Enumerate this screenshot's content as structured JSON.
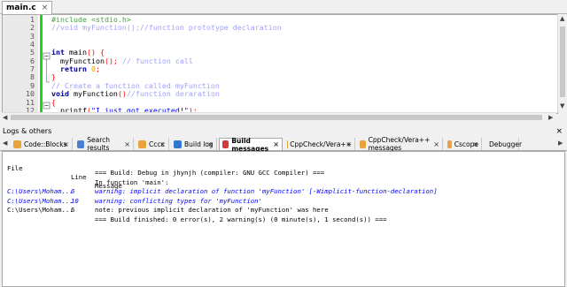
{
  "editor": {
    "tab_label": "main.c",
    "lines": [
      {
        "num": "1",
        "segments": [
          {
            "t": "#include <stdio.h>",
            "c": "pp"
          }
        ]
      },
      {
        "num": "2",
        "segments": [
          {
            "t": "//void myFunction();//function prototype declaration",
            "c": "cm"
          }
        ]
      },
      {
        "num": "3",
        "segments": []
      },
      {
        "num": "4",
        "segments": []
      },
      {
        "num": "5",
        "segments": [
          {
            "t": "int",
            "c": "kw"
          },
          {
            "t": " main",
            "c": "fn"
          },
          {
            "t": "()",
            "c": "sym"
          },
          {
            "t": " {",
            "c": "sym"
          }
        ]
      },
      {
        "num": "6",
        "segments": [
          {
            "t": "  myFunction",
            "c": "fn"
          },
          {
            "t": "();",
            "c": "sym"
          },
          {
            "t": " // function call",
            "c": "cm"
          }
        ]
      },
      {
        "num": "7",
        "segments": [
          {
            "t": "  return",
            "c": "kw"
          },
          {
            "t": " 0",
            "c": "num"
          },
          {
            "t": ";",
            "c": "sym"
          }
        ]
      },
      {
        "num": "8",
        "segments": [
          {
            "t": "}",
            "c": "sym"
          }
        ]
      },
      {
        "num": "9",
        "segments": [
          {
            "t": "// Create a function called myFunction",
            "c": "cm"
          }
        ]
      },
      {
        "num": "10",
        "segments": [
          {
            "t": "void",
            "c": "kw"
          },
          {
            "t": " myFunction",
            "c": "fn"
          },
          {
            "t": "()",
            "c": "sym"
          },
          {
            "t": "//function deraration",
            "c": "cm"
          }
        ]
      },
      {
        "num": "11",
        "segments": [
          {
            "t": "{",
            "c": "sym"
          }
        ]
      },
      {
        "num": "12",
        "segments": [
          {
            "t": "  printf",
            "c": "fn"
          },
          {
            "t": "(",
            "c": "sym"
          },
          {
            "t": "\"I just got executed!\"",
            "c": "str"
          },
          {
            "t": ");",
            "c": "sym"
          }
        ]
      }
    ]
  },
  "logs_panel": {
    "title": "Logs & others",
    "tabs": [
      {
        "label": "Code::Blocks",
        "icon": "codeblocks-icon",
        "color": "#e8a33c"
      },
      {
        "label": "Search results",
        "icon": "search-icon",
        "color": "#4a7fd1"
      },
      {
        "label": "Cccc",
        "icon": "cccc-icon",
        "color": "#e8a33c"
      },
      {
        "label": "Build log",
        "icon": "gear-icon",
        "color": "#2f77d0"
      },
      {
        "label": "Build messages",
        "icon": "build-messages-icon",
        "color": "#d43c3c"
      },
      {
        "label": "CppCheck/Vera++",
        "icon": "cppcheck-icon",
        "color": "#e8a33c"
      },
      {
        "label": "CppCheck/Vera++ messages",
        "icon": "cppcheck-messages-icon",
        "color": "#e8a33c"
      },
      {
        "label": "Cscope",
        "icon": "cscope-icon",
        "color": "#e8a33c"
      },
      {
        "label": "Debugger",
        "icon": "debugger-icon",
        "color": "#2f77d0"
      }
    ],
    "columns": {
      "file": "File",
      "line": "Line",
      "message": "Message"
    },
    "rows": [
      {
        "file": "",
        "line": "",
        "message": "=== Build: Debug in jhynjh (compiler: GNU GCC Compiler) ===",
        "style": "normal"
      },
      {
        "file": "",
        "line": "",
        "message": "In function 'main':",
        "style": "normal"
      },
      {
        "file": "C:\\Users\\Moham...",
        "line": "6",
        "message": "warning: implicit declaration of function 'myFunction' [-Wimplicit-function-declaration]",
        "style": "warn"
      },
      {
        "file": "C:\\Users\\Moham...",
        "line": "10",
        "message": "warning: conflicting types for 'myFunction'",
        "style": "warn"
      },
      {
        "file": "C:\\Users\\Moham...",
        "line": "6",
        "message": "note: previous implicit declaration of 'myFunction' was here",
        "style": "normal"
      },
      {
        "file": "",
        "line": "",
        "message": "=== Build finished: 0 error(s), 2 warning(s) (0 minute(s), 1 second(s)) ===",
        "style": "normal"
      }
    ]
  },
  "glyphs": {
    "close": "×",
    "left": "◀",
    "right": "▶",
    "up": "▲",
    "down": "▼"
  }
}
